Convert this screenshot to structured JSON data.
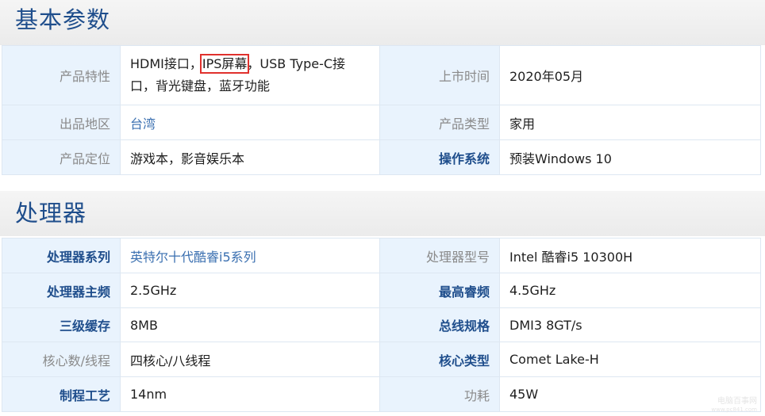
{
  "basic": {
    "title": "基本参数",
    "rows": [
      {
        "l_label": "产品特性",
        "l_value_1": "HDMI接口，",
        "l_value_hl": "IPS屏幕",
        "l_value_2": "，USB Type-C接口，背光键盘，蓝牙功能",
        "r_label": "上市时间",
        "r_value": "2020年05月"
      },
      {
        "l_label": "出品地区",
        "l_value": "台湾",
        "r_label": "产品类型",
        "r_value": "家用"
      },
      {
        "l_label": "产品定位",
        "l_value": "游戏本，影音娱乐本",
        "r_label": "操作系统",
        "r_value": "预装Windows 10"
      }
    ]
  },
  "cpu": {
    "title": "处理器",
    "rows": [
      {
        "l_label": "处理器系列",
        "l_value": "英特尔十代酷睿i5系列",
        "r_label": "处理器型号",
        "r_value": "Intel 酷睿i5 10300H"
      },
      {
        "l_label": "处理器主频",
        "l_value": "2.5GHz",
        "r_label": "最高睿频",
        "r_value": "4.5GHz"
      },
      {
        "l_label": "三级缓存",
        "l_value": "8MB",
        "r_label": "总线规格",
        "r_value": "DMI3 8GT/s"
      },
      {
        "l_label": "核心数/线程",
        "l_value": "四核心/八线程",
        "r_label": "核心类型",
        "r_value": "Comet Lake-H"
      },
      {
        "l_label": "制程工艺",
        "l_value": "14nm",
        "r_label": "功耗",
        "r_value": "45W"
      }
    ]
  },
  "watermark": {
    "line1": "电脑百事网",
    "line2": "www.pc841.com"
  }
}
